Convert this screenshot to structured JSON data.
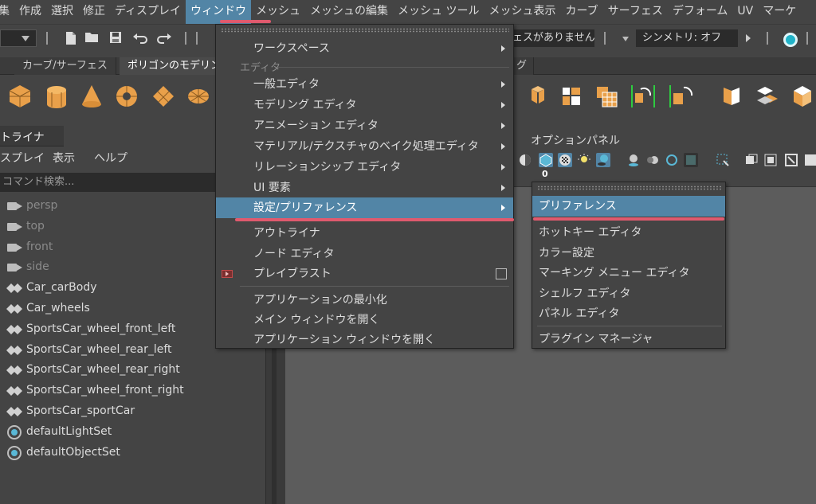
{
  "menubar": {
    "items": [
      "集",
      "作成",
      "選択",
      "修正",
      "ディスプレイ",
      "ウィンドウ",
      "メッシュ",
      "メッシュの編集",
      "メッシュ ツール",
      "メッシュ表示",
      "カーブ",
      "サーフェス",
      "デフォーム",
      "UV",
      "マーケ"
    ]
  },
  "statusline": {
    "no_selection": "ェスがありません",
    "symmetry": "シンメトリ: オフ"
  },
  "shelf_tabs": [
    "カーブ/サーフェス",
    "ポリゴンのモデリング",
    "グ"
  ],
  "outliner": {
    "title": "トライナ",
    "menu": [
      "スプレイ",
      "表示",
      "ヘルプ"
    ],
    "search_placeholder": "コマンド検索...",
    "items": [
      {
        "label": "persp",
        "type": "camera"
      },
      {
        "label": "top",
        "type": "camera"
      },
      {
        "label": "front",
        "type": "camera"
      },
      {
        "label": "side",
        "type": "camera"
      },
      {
        "label": "Car_carBody",
        "type": "transform"
      },
      {
        "label": "Car_wheels",
        "type": "transform"
      },
      {
        "label": "SportsCar_wheel_front_left",
        "type": "transform"
      },
      {
        "label": "SportsCar_wheel_rear_left",
        "type": "transform"
      },
      {
        "label": "SportsCar_wheel_rear_right",
        "type": "transform"
      },
      {
        "label": "SportsCar_wheel_front_right",
        "type": "transform"
      },
      {
        "label": "SportsCar_sportCar",
        "type": "transform"
      },
      {
        "label": "defaultLightSet",
        "type": "set"
      },
      {
        "label": "defaultObjectSet",
        "type": "set"
      }
    ]
  },
  "viewport": {
    "menu": [
      "オプション",
      "パネル"
    ],
    "counter": "0"
  },
  "window_menu": {
    "workspace": "ワークスペース",
    "section_editors": "エディタ",
    "general_editors": "一般エディタ",
    "modeling_editors": "モデリング エディタ",
    "animation_editors": "アニメーション エディタ",
    "material_editors": "マテリアル/テクスチャのベイク処理エディタ",
    "relationship_editors": "リレーションシップ エディタ",
    "ui_elements": "UI 要素",
    "settings_prefs": "設定/プリファレンス",
    "outliner": "アウトライナ",
    "node_editor": "ノード エディタ",
    "playblast": "プレイブラスト",
    "minimize_app": "アプリケーションの最小化",
    "open_main_window": "メイン ウィンドウを開く",
    "open_app_window": "アプリケーション ウィンドウを開く"
  },
  "submenu": {
    "preferences": "プリファレンス",
    "hotkey_editor": "ホットキー エディタ",
    "color_settings": "カラー設定",
    "marking_menu_editor": "マーキング メニュー エディタ",
    "shelf_editor": "シェルフ エディタ",
    "panel_editor": "パネル エディタ",
    "plugin_manager": "プラグイン マネージャ"
  },
  "colors": {
    "highlight": "#5285a6",
    "annotation_red": "#e05a6e",
    "shelf_orange": "#e9a04a"
  }
}
